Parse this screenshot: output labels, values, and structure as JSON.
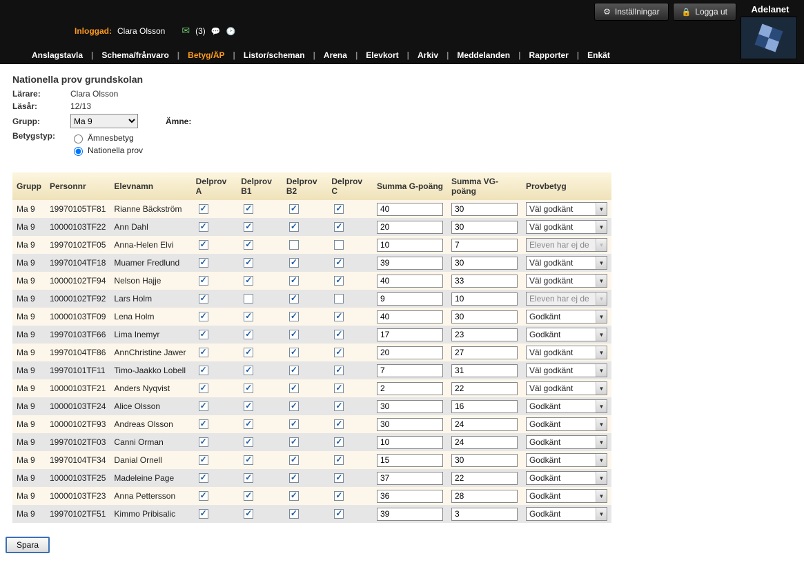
{
  "brand": "Adelanet",
  "top_buttons": {
    "settings": "Inställningar",
    "logout": "Logga ut"
  },
  "session": {
    "label": "Inloggad:",
    "user": "Clara Olsson",
    "count": "(3)"
  },
  "nav": [
    "Anslagstavla",
    "Schema/frånvaro",
    "Betyg/ÄP",
    "Listor/scheman",
    "Arena",
    "Elevkort",
    "Arkiv",
    "Meddelanden",
    "Rapporter",
    "Enkät"
  ],
  "nav_active_index": 2,
  "page_title": "Nationella prov grundskolan",
  "meta": {
    "larare_label": "Lärare:",
    "larare": "Clara Olsson",
    "lasar_label": "Läsår:",
    "lasar": "12/13",
    "grupp_label": "Grupp:",
    "grupp": "Ma 9",
    "amne_label": "Ämne:",
    "betygstyp_label": "Betygstyp:",
    "radio1": "Ämnesbetyg",
    "radio2": "Nationella prov"
  },
  "columns": {
    "grupp": "Grupp",
    "personnr": "Personnr",
    "elevnamn": "Elevnamn",
    "dpa": "Delprov A",
    "dpb1": "Delprov B1",
    "dpb2": "Delprov B2",
    "dpc": "Delprov C",
    "sumg": "Summa G-poäng",
    "sumvg": "Summa VG-poäng",
    "provbetyg": "Provbetyg"
  },
  "rows": [
    {
      "grupp": "Ma 9",
      "pnr": "19970105TF81",
      "namn": "Rianne Bäckström",
      "a": true,
      "b1": true,
      "b2": true,
      "c": true,
      "g": "40",
      "vg": "30",
      "betyg": "Väl godkänt",
      "disabled": false
    },
    {
      "grupp": "Ma 9",
      "pnr": "10000103TF22",
      "namn": "Ann Dahl",
      "a": true,
      "b1": true,
      "b2": true,
      "c": true,
      "g": "20",
      "vg": "30",
      "betyg": "Väl godkänt",
      "disabled": false
    },
    {
      "grupp": "Ma 9",
      "pnr": "19970102TF05",
      "namn": "Anna-Helen Elvi",
      "a": true,
      "b1": true,
      "b2": false,
      "c": false,
      "g": "10",
      "vg": "7",
      "betyg": "Eleven har ej de",
      "disabled": true
    },
    {
      "grupp": "Ma 9",
      "pnr": "19970104TF18",
      "namn": "Muamer Fredlund",
      "a": true,
      "b1": true,
      "b2": true,
      "c": true,
      "g": "39",
      "vg": "30",
      "betyg": "Väl godkänt",
      "disabled": false
    },
    {
      "grupp": "Ma 9",
      "pnr": "10000102TF94",
      "namn": "Nelson Hajje",
      "a": true,
      "b1": true,
      "b2": true,
      "c": true,
      "g": "40",
      "vg": "33",
      "betyg": "Väl godkänt",
      "disabled": false
    },
    {
      "grupp": "Ma 9",
      "pnr": "10000102TF92",
      "namn": "Lars Holm",
      "a": true,
      "b1": false,
      "b2": true,
      "c": false,
      "g": "9",
      "vg": "10",
      "betyg": "Eleven har ej de",
      "disabled": true
    },
    {
      "grupp": "Ma 9",
      "pnr": "10000103TF09",
      "namn": "Lena Holm",
      "a": true,
      "b1": true,
      "b2": true,
      "c": true,
      "g": "40",
      "vg": "30",
      "betyg": "Godkänt",
      "disabled": false
    },
    {
      "grupp": "Ma 9",
      "pnr": "19970103TF66",
      "namn": "Lima Inemyr",
      "a": true,
      "b1": true,
      "b2": true,
      "c": true,
      "g": "17",
      "vg": "23",
      "betyg": "Godkänt",
      "disabled": false
    },
    {
      "grupp": "Ma 9",
      "pnr": "19970104TF86",
      "namn": "AnnChristine Jawer",
      "a": true,
      "b1": true,
      "b2": true,
      "c": true,
      "g": "20",
      "vg": "27",
      "betyg": "Väl godkänt",
      "disabled": false
    },
    {
      "grupp": "Ma 9",
      "pnr": "19970101TF11",
      "namn": "Timo-Jaakko Lobell",
      "a": true,
      "b1": true,
      "b2": true,
      "c": true,
      "g": "7",
      "vg": "31",
      "betyg": "Väl godkänt",
      "disabled": false
    },
    {
      "grupp": "Ma 9",
      "pnr": "10000103TF21",
      "namn": "Anders Nyqvist",
      "a": true,
      "b1": true,
      "b2": true,
      "c": true,
      "g": "2",
      "vg": "22",
      "betyg": "Väl godkänt",
      "disabled": false
    },
    {
      "grupp": "Ma 9",
      "pnr": "10000103TF24",
      "namn": "Alice Olsson",
      "a": true,
      "b1": true,
      "b2": true,
      "c": true,
      "g": "30",
      "vg": "16",
      "betyg": "Godkänt",
      "disabled": false
    },
    {
      "grupp": "Ma 9",
      "pnr": "10000102TF93",
      "namn": "Andreas Olsson",
      "a": true,
      "b1": true,
      "b2": true,
      "c": true,
      "g": "30",
      "vg": "24",
      "betyg": "Godkänt",
      "disabled": false
    },
    {
      "grupp": "Ma 9",
      "pnr": "19970102TF03",
      "namn": "Canni Orman",
      "a": true,
      "b1": true,
      "b2": true,
      "c": true,
      "g": "10",
      "vg": "24",
      "betyg": "Godkänt",
      "disabled": false
    },
    {
      "grupp": "Ma 9",
      "pnr": "19970104TF34",
      "namn": "Danial Ornell",
      "a": true,
      "b1": true,
      "b2": true,
      "c": true,
      "g": "15",
      "vg": "30",
      "betyg": "Godkänt",
      "disabled": false
    },
    {
      "grupp": "Ma 9",
      "pnr": "10000103TF25",
      "namn": "Madeleine Page",
      "a": true,
      "b1": true,
      "b2": true,
      "c": true,
      "g": "37",
      "vg": "22",
      "betyg": "Godkänt",
      "disabled": false
    },
    {
      "grupp": "Ma 9",
      "pnr": "10000103TF23",
      "namn": "Anna Pettersson",
      "a": true,
      "b1": true,
      "b2": true,
      "c": true,
      "g": "36",
      "vg": "28",
      "betyg": "Godkänt",
      "disabled": false
    },
    {
      "grupp": "Ma 9",
      "pnr": "19970102TF51",
      "namn": "Kimmo Pribisalic",
      "a": true,
      "b1": true,
      "b2": true,
      "c": true,
      "g": "39",
      "vg": "3",
      "betyg": "Godkänt",
      "disabled": false
    }
  ],
  "save_label": "Spara"
}
